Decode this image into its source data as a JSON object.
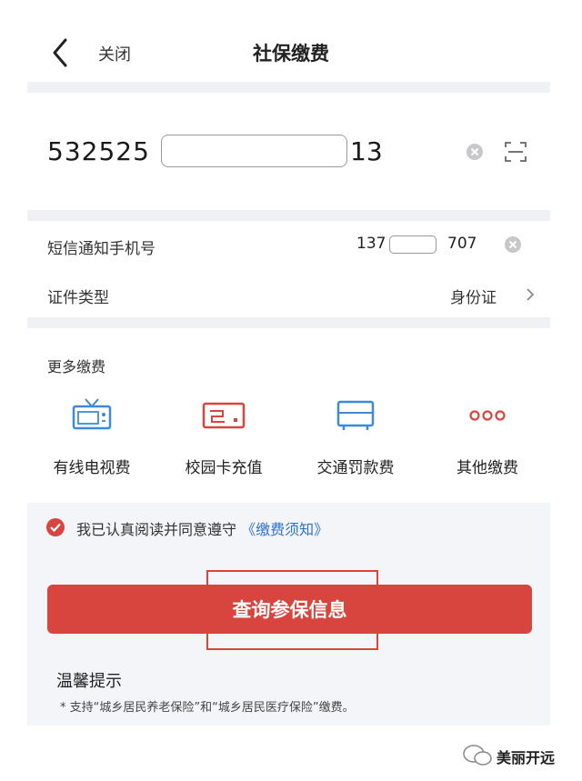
{
  "header": {
    "back_icon": "chevron-left-icon",
    "close_label": "关闭",
    "title": "社保缴费"
  },
  "id_number": {
    "prefix": "532525",
    "suffix": "13",
    "clear_icon": "clear-icon",
    "scan_icon": "scan-icon"
  },
  "phone": {
    "label": "短信通知手机号",
    "prefix": "137",
    "suffix": "707",
    "clear_icon": "clear-icon"
  },
  "id_type": {
    "label": "证件类型",
    "value": "身份证"
  },
  "more_payments": {
    "title": "更多缴费",
    "items": [
      {
        "label": "有线电视费",
        "icon": "tv-icon"
      },
      {
        "label": "校园卡充值",
        "icon": "campus-card-icon"
      },
      {
        "label": "交通罚款费",
        "icon": "traffic-fine-icon"
      },
      {
        "label": "其他缴费",
        "icon": "more-dots-icon"
      }
    ]
  },
  "agreement": {
    "text": "我已认真阅读并同意遵守",
    "link": "《缴费须知》",
    "checked": true
  },
  "query_button": {
    "label": "查询参保信息"
  },
  "tips": {
    "title": "温馨提示",
    "text": "* 支持“城乡居民养老保险”和“城乡居民医疗保险”缴费。"
  },
  "watermark": {
    "text": "美丽开远"
  },
  "colors": {
    "accent_red": "#d8453f",
    "link_blue": "#2f73c9",
    "icon_blue": "#3c8ad8",
    "divider_gray": "#f0f1f5"
  }
}
